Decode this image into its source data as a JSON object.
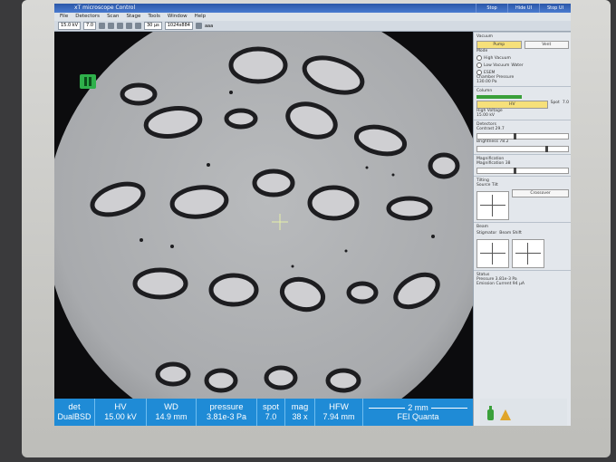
{
  "app": {
    "title": "xT microscope Control",
    "title_right_items": [
      "Stop",
      "Hide UI",
      "Stop UI"
    ],
    "title_right_extra": "Pages"
  },
  "menu": [
    "File",
    "Detectors",
    "Scan",
    "Stage",
    "Tools",
    "Window",
    "Help"
  ],
  "toolbar": {
    "hv": "15.0 kV",
    "spot": "7.0",
    "mag": "30 µs",
    "resolution": "1024x884",
    "zoom": "aaa"
  },
  "panel": {
    "vacuum": {
      "title": "Vacuum",
      "pump": "Pump",
      "vent": "Vent",
      "mode_label": "Mode",
      "modes": [
        "High Vacuum",
        "Low Vacuum",
        "ESEM"
      ],
      "water_label": "Water",
      "chamber_pressure_label": "Chamber Pressure",
      "chamber_pressure_value": "130.00 Pa"
    },
    "column": {
      "title": "Column",
      "hv_button": "HV",
      "spot_label": "Spot",
      "spot_value": "7.0",
      "high_voltage_label": "High Voltage",
      "high_voltage_value": "15.00 kV"
    },
    "detectors": {
      "title": "Detectors",
      "contrast_label": "Contrast",
      "contrast_value": "29.7",
      "brightness_label": "Brightness",
      "brightness_value": "78.2"
    },
    "magnification": {
      "title": "Magnification",
      "label": "Magnification",
      "value": "38"
    },
    "tilting": {
      "title": "Tilting",
      "source_tilt": "Source Tilt",
      "crossover": "Crossover"
    },
    "beam": {
      "title": "Beam",
      "stigmator": "Stigmator",
      "beam_shift": "Beam Shift"
    },
    "status": {
      "title": "Status",
      "pressure_label": "Pressure",
      "pressure_value": "3.81e-3",
      "pressure_unit": "Pa",
      "emission_label": "Emission Current",
      "emission_value": "94",
      "emission_unit": "µA"
    }
  },
  "databar": {
    "det_label": "det",
    "det_value": "DualBSD",
    "hv_label": "HV",
    "hv_value": "15.00 kV",
    "wd_label": "WD",
    "wd_value": "14.9 mm",
    "pressure_label": "pressure",
    "pressure_value": "3.81e-3 Pa",
    "spot_label": "spot",
    "spot_value": "7.0",
    "mag_label": "mag",
    "mag_value": "38 x",
    "hfw_label": "HFW",
    "hfw_value": "7.94 mm",
    "scale_label": "2 mm",
    "instrument": "FEI Quanta"
  },
  "colors": {
    "databar": "#1f8bd6",
    "titlebar": "#2b57a8",
    "pause_button": "#2fb04b",
    "pump_active": "#f6e07a"
  },
  "icons": [
    "pause-icon",
    "crosshair-icon",
    "bottle-icon",
    "triangle-icon"
  ]
}
